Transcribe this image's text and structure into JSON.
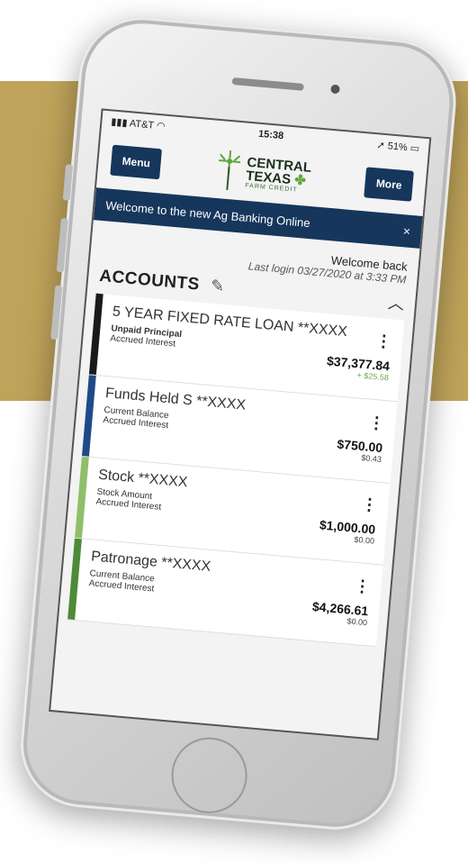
{
  "status_bar": {
    "carrier": "AT&T",
    "time": "15:38",
    "battery": "51%"
  },
  "topbar": {
    "menu_label": "Menu",
    "more_label": "More",
    "logo_line1": "CENTRAL",
    "logo_line2": "TEXAS",
    "logo_sub": "FARM CREDIT"
  },
  "banner": {
    "text": "Welcome to the new Ag Banking Online",
    "close": "×"
  },
  "welcome": {
    "greeting": "Welcome back",
    "last_login": "Last login 03/27/2020 at 3:33 PM"
  },
  "accounts": {
    "title": "ACCOUNTS",
    "items": [
      {
        "name": "5 YEAR FIXED RATE LOAN **XXXX",
        "line1_label": "Unpaid Principal",
        "line2_label": "Accrued Interest",
        "amount": "$37,377.84",
        "sub_amount": "+ $25.58",
        "stripe": "#1a1a1a"
      },
      {
        "name": "Funds Held S **XXXX",
        "line1_label": "Current Balance",
        "line2_label": "Accrued Interest",
        "amount": "$750.00",
        "sub_amount": "$0.43",
        "stripe": "#1f4a8a"
      },
      {
        "name": "Stock **XXXX",
        "line1_label": "Stock Amount",
        "line2_label": "Accrued Interest",
        "amount": "$1,000.00",
        "sub_amount": "$0.00",
        "stripe": "#8fbf6a"
      },
      {
        "name": "Patronage **XXXX",
        "line1_label": "Current Balance",
        "line2_label": "Accrued Interest",
        "amount": "$4,266.61",
        "sub_amount": "$0.00",
        "stripe": "#4d8a3a"
      }
    ]
  },
  "colors": {
    "navy": "#16365c",
    "gold": "#bfa35a"
  }
}
